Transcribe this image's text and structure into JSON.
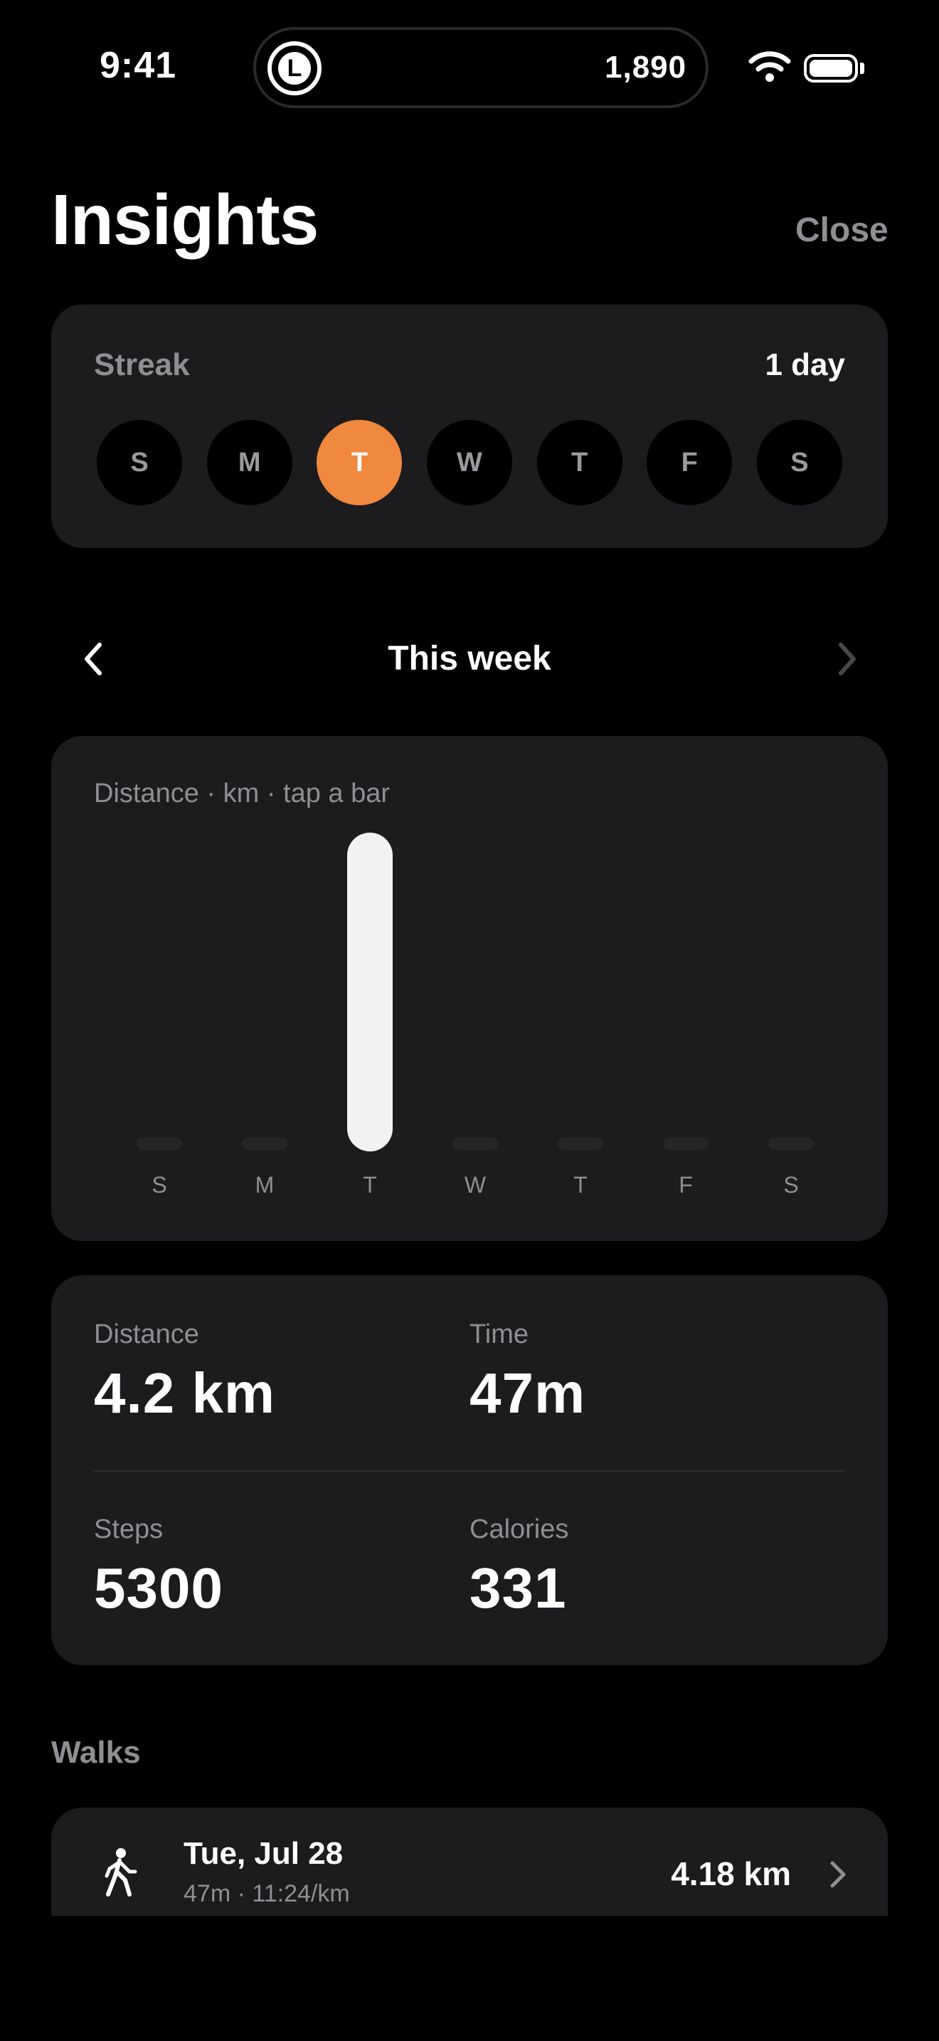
{
  "status_bar": {
    "time": "9:41",
    "island_logo_letter": "L",
    "island_value": "1,890"
  },
  "header": {
    "title": "Insights",
    "close_label": "Close"
  },
  "streak": {
    "label": "Streak",
    "value": "1 day",
    "days": [
      {
        "letter": "S",
        "active": false
      },
      {
        "letter": "M",
        "active": false
      },
      {
        "letter": "T",
        "active": true
      },
      {
        "letter": "W",
        "active": false
      },
      {
        "letter": "T",
        "active": false
      },
      {
        "letter": "F",
        "active": false
      },
      {
        "letter": "S",
        "active": false
      }
    ],
    "accent_color": "#f0883e"
  },
  "week_nav": {
    "title": "This week",
    "prev_icon": "chevron-left-icon",
    "next_icon": "chevron-right-icon"
  },
  "chart": {
    "caption": "Distance · km · tap a bar"
  },
  "chart_data": {
    "type": "bar",
    "categories": [
      "S",
      "M",
      "T",
      "W",
      "T",
      "F",
      "S"
    ],
    "values": [
      0,
      0,
      4.2,
      0,
      0,
      0,
      0
    ],
    "ylim": [
      0,
      4.2
    ],
    "grid": false,
    "bar_color": "#f2f2f2",
    "empty_color": "#262628"
  },
  "stats": {
    "distance_label": "Distance",
    "distance_value": "4.2 km",
    "time_label": "Time",
    "time_value": "47m",
    "steps_label": "Steps",
    "steps_value": "5300",
    "calories_label": "Calories",
    "calories_value": "331"
  },
  "walks": {
    "heading": "Walks",
    "items": [
      {
        "icon": "walking-person-icon",
        "date": "Tue, Jul 28",
        "meta": "47m · 11:24/km",
        "distance": "4.18 km"
      }
    ]
  }
}
